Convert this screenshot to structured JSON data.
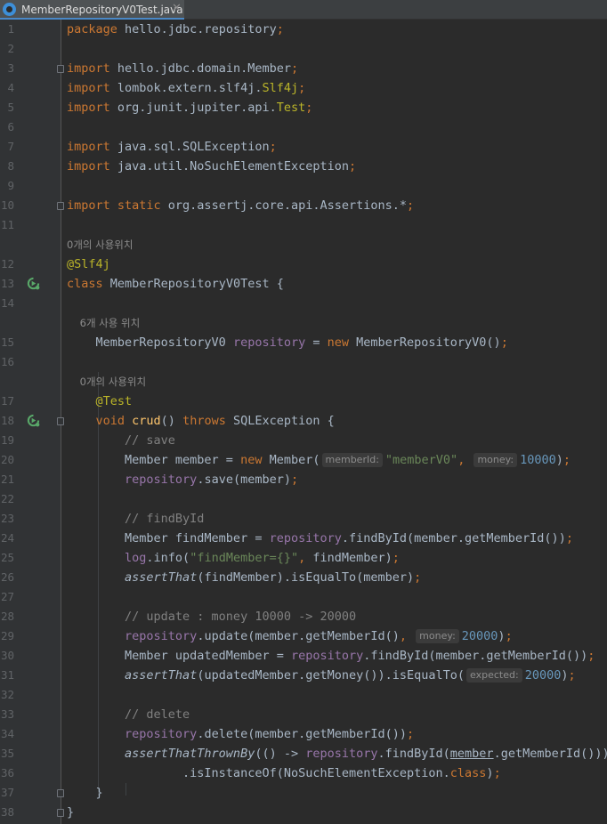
{
  "tab": {
    "filename": "MemberRepositoryV0Test.java",
    "icon": "java-class-icon"
  },
  "lines": [
    {
      "no": "1",
      "t": [
        [
          "kw",
          "package "
        ],
        [
          "",
          "hello.jdbc.repository"
        ],
        [
          "kw",
          ";"
        ]
      ]
    },
    {
      "no": "2",
      "t": []
    },
    {
      "no": "3",
      "t": [
        [
          "kw",
          "import "
        ],
        [
          "",
          "hello.jdbc.domain.Member"
        ],
        [
          "kw",
          ";"
        ]
      ]
    },
    {
      "no": "4",
      "t": [
        [
          "kw",
          "import "
        ],
        [
          "",
          "lombok.extern.slf4j."
        ],
        [
          "ann",
          "Slf4j"
        ],
        [
          "kw",
          ";"
        ]
      ]
    },
    {
      "no": "5",
      "t": [
        [
          "kw",
          "import "
        ],
        [
          "",
          "org.junit.jupiter.api."
        ],
        [
          "ann",
          "Test"
        ],
        [
          "kw",
          ";"
        ]
      ]
    },
    {
      "no": "6",
      "t": []
    },
    {
      "no": "7",
      "t": [
        [
          "kw",
          "import "
        ],
        [
          "",
          "java.sql.SQLException"
        ],
        [
          "kw",
          ";"
        ]
      ]
    },
    {
      "no": "8",
      "t": [
        [
          "kw",
          "import "
        ],
        [
          "",
          "java.util.NoSuchElementException"
        ],
        [
          "kw",
          ";"
        ]
      ]
    },
    {
      "no": "9",
      "t": []
    },
    {
      "no": "10",
      "t": [
        [
          "kw",
          "import static "
        ],
        [
          "",
          "org.assertj.core.api.Assertions.*"
        ],
        [
          "kw",
          ";"
        ]
      ]
    },
    {
      "no": "11",
      "t": []
    },
    {
      "no": "",
      "usage": "0개의 사용위치"
    },
    {
      "no": "12",
      "t": [
        [
          "ann",
          "@Slf4j"
        ]
      ]
    },
    {
      "no": "13",
      "t": [
        [
          "kw",
          "class "
        ],
        [
          "",
          "MemberRepositoryV0Test {"
        ]
      ]
    },
    {
      "no": "14",
      "t": []
    },
    {
      "no": "",
      "usage": "    6개 사용 위치"
    },
    {
      "no": "15",
      "t": [
        [
          "",
          "    MemberRepositoryV0 "
        ],
        [
          "fld",
          "repository"
        ],
        [
          "",
          " = "
        ],
        [
          "kw",
          "new "
        ],
        [
          "",
          "MemberRepositoryV0()"
        ],
        [
          "kw",
          ";"
        ]
      ]
    },
    {
      "no": "16",
      "t": []
    },
    {
      "no": "",
      "usage": "    0개의 사용위치"
    },
    {
      "no": "17",
      "t": [
        [
          "ann",
          "    @Test"
        ]
      ]
    },
    {
      "no": "18",
      "t": [
        [
          "kw",
          "    void "
        ],
        [
          "mdecl",
          "crud"
        ],
        [
          "",
          "() "
        ],
        [
          "kw",
          "throws "
        ],
        [
          "",
          "SQLException {"
        ]
      ]
    },
    {
      "no": "19",
      "t": [
        [
          "cmt",
          "        // save"
        ]
      ]
    },
    {
      "no": "20",
      "t": [
        [
          "",
          "        Member member = "
        ],
        [
          "kw",
          "new "
        ],
        [
          "",
          "Member("
        ],
        [
          "hint",
          "memberId:"
        ],
        [
          "str",
          "\"memberV0\""
        ],
        [
          "kw",
          ","
        ],
        [
          "",
          " "
        ],
        [
          "hint",
          "money:"
        ],
        [
          "num",
          "10000"
        ],
        [
          "",
          ")"
        ],
        [
          "kw",
          ";"
        ]
      ]
    },
    {
      "no": "21",
      "t": [
        [
          "fld",
          "        repository"
        ],
        [
          "",
          ".save(member)"
        ],
        [
          "kw",
          ";"
        ]
      ]
    },
    {
      "no": "22",
      "t": []
    },
    {
      "no": "23",
      "t": [
        [
          "cmt",
          "        // findById"
        ]
      ]
    },
    {
      "no": "24",
      "t": [
        [
          "",
          "        Member findMember = "
        ],
        [
          "fld",
          "repository"
        ],
        [
          "",
          ".findById(member.getMemberId())"
        ],
        [
          "kw",
          ";"
        ]
      ]
    },
    {
      "no": "25",
      "t": [
        [
          "fld",
          "        log"
        ],
        [
          "",
          ".info("
        ],
        [
          "str",
          "\"findMember={}\""
        ],
        [
          "kw",
          ","
        ],
        [
          "",
          " findMember)"
        ],
        [
          "kw",
          ";"
        ]
      ]
    },
    {
      "no": "26",
      "t": [
        [
          "it",
          "        assertThat"
        ],
        [
          "",
          "(findMember).isEqualTo(member)"
        ],
        [
          "kw",
          ";"
        ]
      ]
    },
    {
      "no": "27",
      "t": []
    },
    {
      "no": "28",
      "t": [
        [
          "cmt",
          "        // update : money 10000 -> 20000"
        ]
      ]
    },
    {
      "no": "29",
      "t": [
        [
          "fld",
          "        repository"
        ],
        [
          "",
          ".update(member.getMemberId()"
        ],
        [
          "kw",
          ","
        ],
        [
          "",
          " "
        ],
        [
          "hint",
          "money:"
        ],
        [
          "num",
          "20000"
        ],
        [
          "",
          ")"
        ],
        [
          "kw",
          ";"
        ]
      ]
    },
    {
      "no": "30",
      "t": [
        [
          "",
          "        Member updatedMember = "
        ],
        [
          "fld",
          "repository"
        ],
        [
          "",
          ".findById(member.getMemberId())"
        ],
        [
          "kw",
          ";"
        ]
      ]
    },
    {
      "no": "31",
      "t": [
        [
          "it",
          "        assertThat"
        ],
        [
          "",
          "(updatedMember.getMoney()).isEqualTo("
        ],
        [
          "hint",
          "expected:"
        ],
        [
          "num",
          "20000"
        ],
        [
          "",
          ")"
        ],
        [
          "kw",
          ";"
        ]
      ]
    },
    {
      "no": "32",
      "t": []
    },
    {
      "no": "33",
      "t": [
        [
          "cmt",
          "        // delete"
        ]
      ]
    },
    {
      "no": "34",
      "t": [
        [
          "fld",
          "        repository"
        ],
        [
          "",
          ".delete(member.getMemberId())"
        ],
        [
          "kw",
          ";"
        ]
      ]
    },
    {
      "no": "35",
      "t": [
        [
          "it",
          "        assertThatThrownBy"
        ],
        [
          "",
          "(() -> "
        ],
        [
          "fld",
          "repository"
        ],
        [
          "",
          ".findById("
        ],
        [
          "ul",
          "member"
        ],
        [
          "",
          ".getMemberId()))"
        ]
      ]
    },
    {
      "no": "36",
      "t": [
        [
          "",
          "                .isInstanceOf(NoSuchElementException."
        ],
        [
          "kw",
          "class"
        ],
        [
          "",
          ")"
        ],
        [
          "kw",
          ";"
        ]
      ]
    },
    {
      "no": "37",
      "t": [
        [
          "",
          "    }"
        ]
      ]
    },
    {
      "no": "38",
      "t": [
        [
          "",
          "}"
        ]
      ]
    }
  ],
  "colors": {
    "background": "#2b2b2b",
    "gutter": "#313335",
    "keyword": "#cc7832",
    "annotation": "#bbb529",
    "string": "#6a8759",
    "number": "#6897bb",
    "comment": "#808080",
    "field": "#9876aa",
    "method_decl": "#ffc66d",
    "default": "#a9b7c6"
  },
  "gutter_icons": [
    {
      "line": "13",
      "icon": "run-test-icon"
    },
    {
      "line": "18",
      "icon": "run-test-icon"
    }
  ]
}
